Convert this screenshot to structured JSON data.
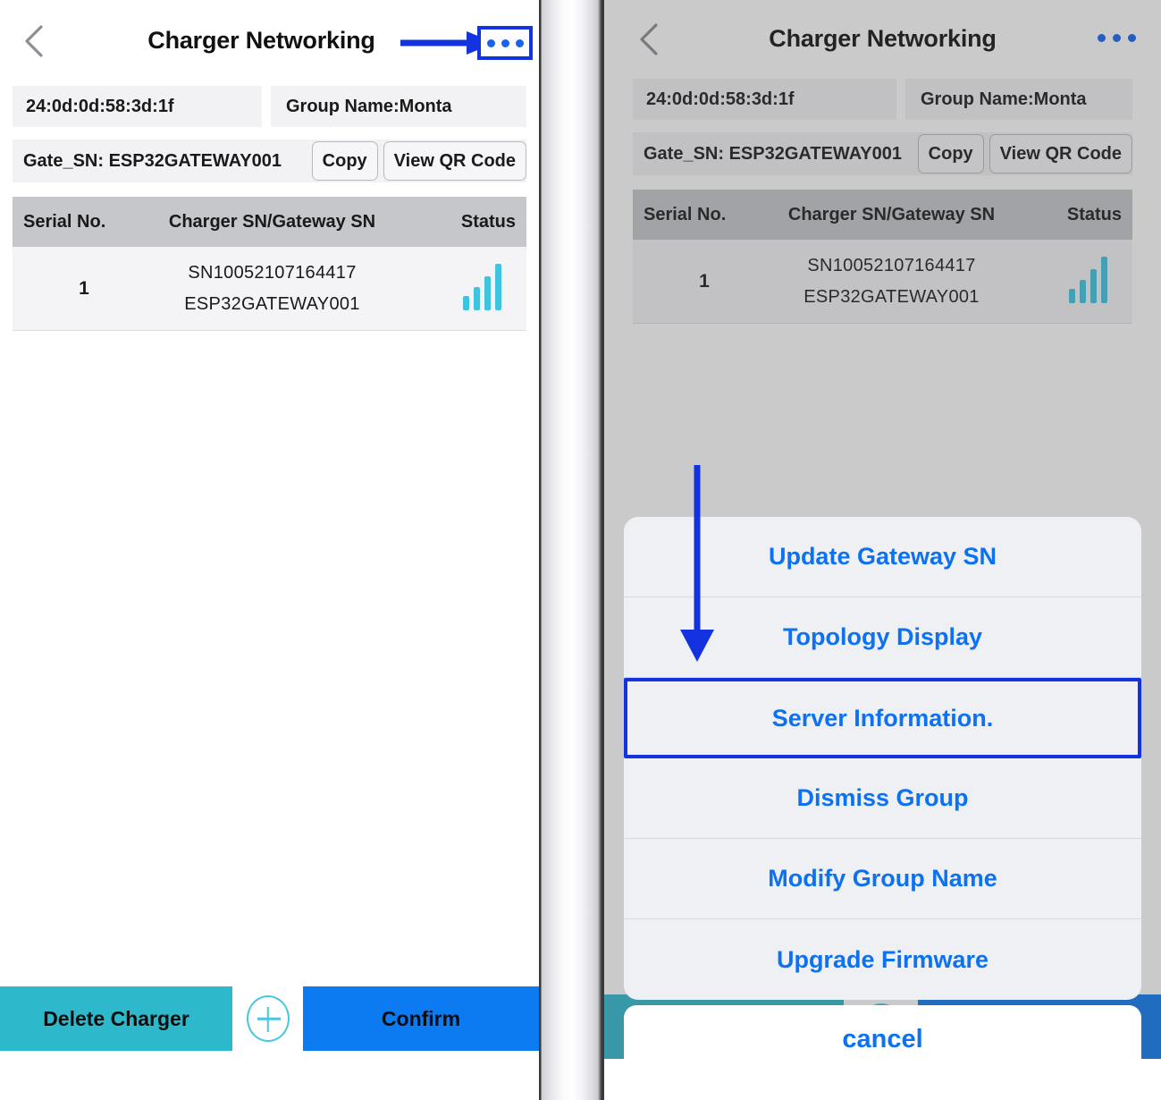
{
  "screen": {
    "title": "Charger Networking",
    "back_icon": "chevron-left-icon",
    "kebab_icon": "more-options-icon"
  },
  "info": {
    "mac_address": "24:0d:0d:58:3d:1f",
    "group_name": "Group Name:Monta",
    "gateway_label": "Gate_SN: ESP32GATEWAY001",
    "copy_label": "Copy",
    "qr_label": "View QR Code"
  },
  "table": {
    "columns": {
      "serial": "Serial No.",
      "sn": "Charger SN/Gateway SN",
      "status": "Status"
    },
    "rows": [
      {
        "serial": "1",
        "charger_sn": "SN10052107164417",
        "gateway_sn": "ESP32GATEWAY001",
        "status_icon": "signal-bars-icon",
        "signal_bars": 4
      }
    ]
  },
  "bottom_bar": {
    "delete_label": "Delete Charger",
    "add_icon": "plus-circle-icon",
    "confirm_label": "Confirm"
  },
  "action_sheet": {
    "items": [
      {
        "label": "Update Gateway SN",
        "highlighted": false
      },
      {
        "label": "Topology Display",
        "highlighted": false
      },
      {
        "label": "Server Information.",
        "highlighted": true
      },
      {
        "label": "Dismiss Group",
        "highlighted": false
      },
      {
        "label": "Modify Group Name",
        "highlighted": false
      },
      {
        "label": "Upgrade Firmware",
        "highlighted": false
      }
    ],
    "cancel_label": "cancel"
  },
  "annotations": {
    "arrow_to_kebab": "right-arrow-annotation",
    "arrow_to_server_info": "down-arrow-annotation",
    "highlight_color": "#1433e0"
  },
  "colors": {
    "accent_blue": "#0c72f3",
    "confirm_blue": "#0c7af0",
    "delete_teal": "#2eb8cc",
    "signal_cyan": "#3fc4e0",
    "header_gray": "#c6c7cb",
    "field_gray": "#f2f2f4"
  }
}
